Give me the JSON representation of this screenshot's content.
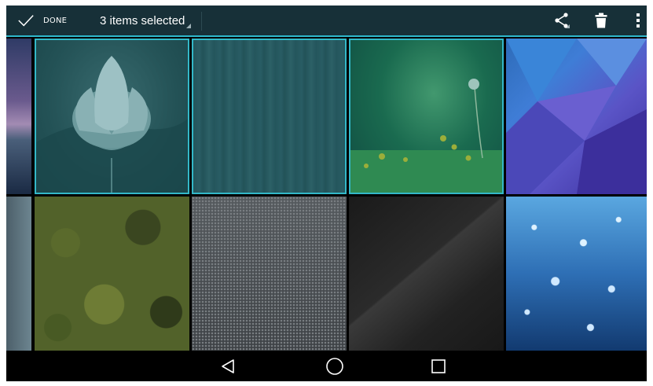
{
  "action_bar": {
    "done_label": "DONE",
    "selection_label": "3 items selected",
    "icons": [
      "check-icon",
      "share-icon",
      "trash-icon",
      "overflow-menu-icon"
    ],
    "background": "#173038",
    "accent": "#2fb8cc"
  },
  "grid": {
    "tiles": [
      {
        "name": "peek-1",
        "selected": false
      },
      {
        "name": "lotus",
        "selected": true
      },
      {
        "name": "wood",
        "selected": true
      },
      {
        "name": "dandelion",
        "selected": true
      },
      {
        "name": "poly",
        "selected": false
      },
      {
        "name": "peek-2",
        "selected": false
      },
      {
        "name": "camo",
        "selected": false
      },
      {
        "name": "metal",
        "selected": false
      },
      {
        "name": "dark",
        "selected": false
      },
      {
        "name": "rain",
        "selected": false
      }
    ]
  },
  "navigation_bar": {
    "icons": [
      "back-icon",
      "home-icon",
      "recents-icon"
    ]
  }
}
